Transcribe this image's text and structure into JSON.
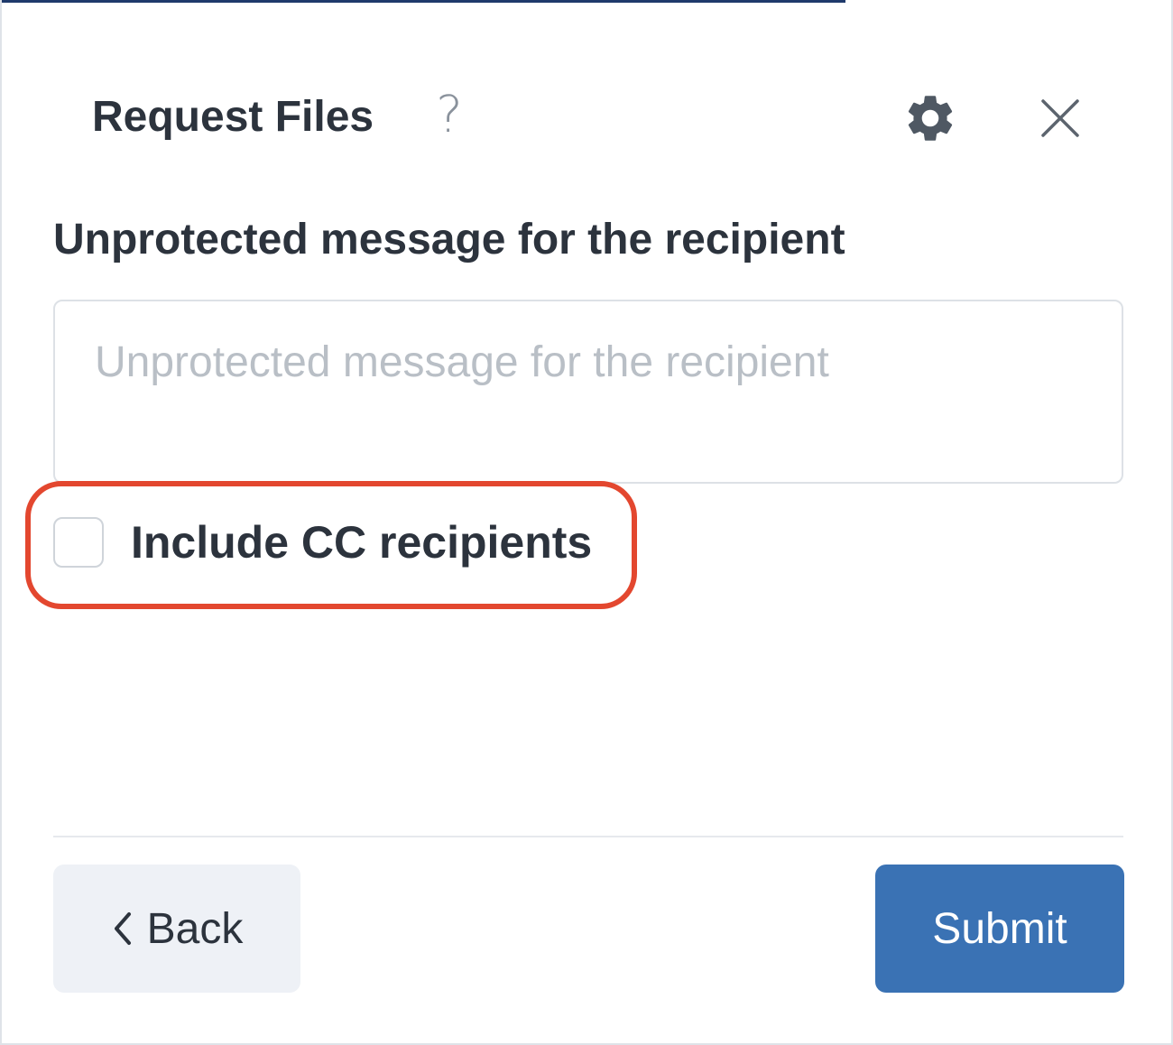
{
  "dialog": {
    "title": "Request Files",
    "help_glyph": "?",
    "icons": {
      "help": "question-mark-icon",
      "settings": "gear-icon",
      "close": "close-icon"
    }
  },
  "message": {
    "label": "Unprotected message for the recipient",
    "value": "",
    "placeholder": "Unprotected message for the recipient"
  },
  "cc": {
    "label": "Include CC recipients",
    "checked": false
  },
  "footer": {
    "back_label": "Back",
    "submit_label": "Submit"
  },
  "colors": {
    "primary": "#3a72b4",
    "highlight": "#e3472f",
    "text": "#2c333d",
    "secondary_button": "#eef1f6"
  }
}
